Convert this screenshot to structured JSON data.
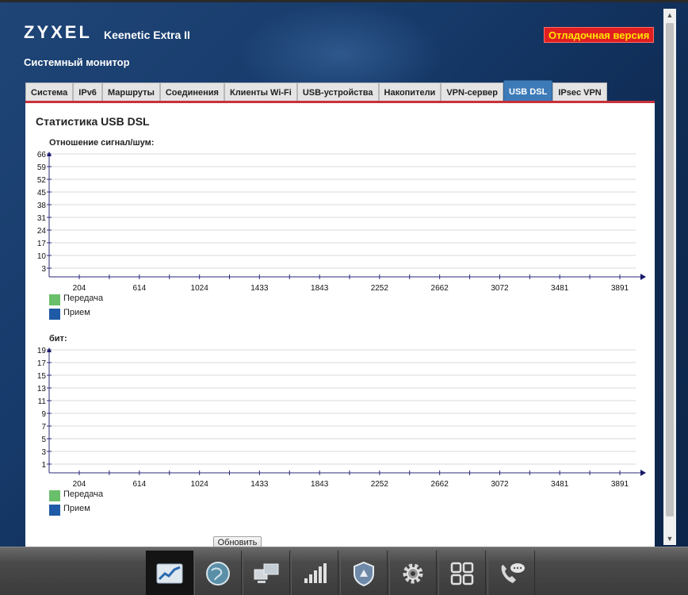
{
  "header": {
    "logo": "ZYXEL",
    "model": "Keenetic Extra II",
    "debug_badge": "Отладочная версия",
    "page_title": "Системный монитор"
  },
  "tabs": [
    {
      "label": "Система",
      "active": false
    },
    {
      "label": "IPv6",
      "active": false
    },
    {
      "label": "Маршруты",
      "active": false
    },
    {
      "label": "Соединения",
      "active": false
    },
    {
      "label": "Клиенты Wi-Fi",
      "active": false
    },
    {
      "label": "USB-устройства",
      "active": false
    },
    {
      "label": "Накопители",
      "active": false
    },
    {
      "label": "VPN-сервер",
      "active": false
    },
    {
      "label": "USB DSL",
      "active": true
    },
    {
      "label": "IPsec VPN",
      "active": false
    }
  ],
  "panel": {
    "title": "Статистика USB DSL",
    "refresh_button": "Обновить"
  },
  "charts": {
    "snr": {
      "label": "Отношение сигнал/шум:",
      "legend": {
        "tx": "Передача",
        "rx": "Прием"
      }
    },
    "bits": {
      "label": "бит:",
      "legend": {
        "tx": "Передача",
        "rx": "Прием"
      }
    }
  },
  "colors": {
    "tx": "#6abf6a",
    "rx": "#1f5aa6",
    "accent": "#c9303a",
    "active_tab": "#3d7bb8"
  },
  "chart_data": [
    {
      "type": "bar",
      "ylabel": "Отношение сигнал/шум:",
      "yticks": [
        66,
        59,
        52,
        45,
        38,
        31,
        24,
        17,
        10,
        3
      ],
      "xticks": [
        204,
        614,
        1024,
        1433,
        1843,
        2252,
        2662,
        3072,
        3481,
        3891
      ],
      "series": [
        {
          "name": "Передача",
          "values": []
        },
        {
          "name": "Прием",
          "values": []
        }
      ]
    },
    {
      "type": "bar",
      "ylabel": "бит:",
      "yticks": [
        19,
        17,
        15,
        13,
        11,
        9,
        7,
        5,
        3,
        1
      ],
      "xticks": [
        204,
        614,
        1024,
        1433,
        1843,
        2252,
        2662,
        3072,
        3481,
        3891
      ],
      "series": [
        {
          "name": "Передача",
          "values": []
        },
        {
          "name": "Прием",
          "values": []
        }
      ]
    }
  ],
  "taskbar": [
    {
      "icon": "monitor-chart-icon",
      "active": true
    },
    {
      "icon": "globe-icon",
      "active": false
    },
    {
      "icon": "computers-icon",
      "active": false
    },
    {
      "icon": "wifi-signal-icon",
      "active": false
    },
    {
      "icon": "shield-icon",
      "active": false
    },
    {
      "icon": "gear-icon",
      "active": false
    },
    {
      "icon": "apps-grid-icon",
      "active": false
    },
    {
      "icon": "phone-icon",
      "active": false
    }
  ]
}
